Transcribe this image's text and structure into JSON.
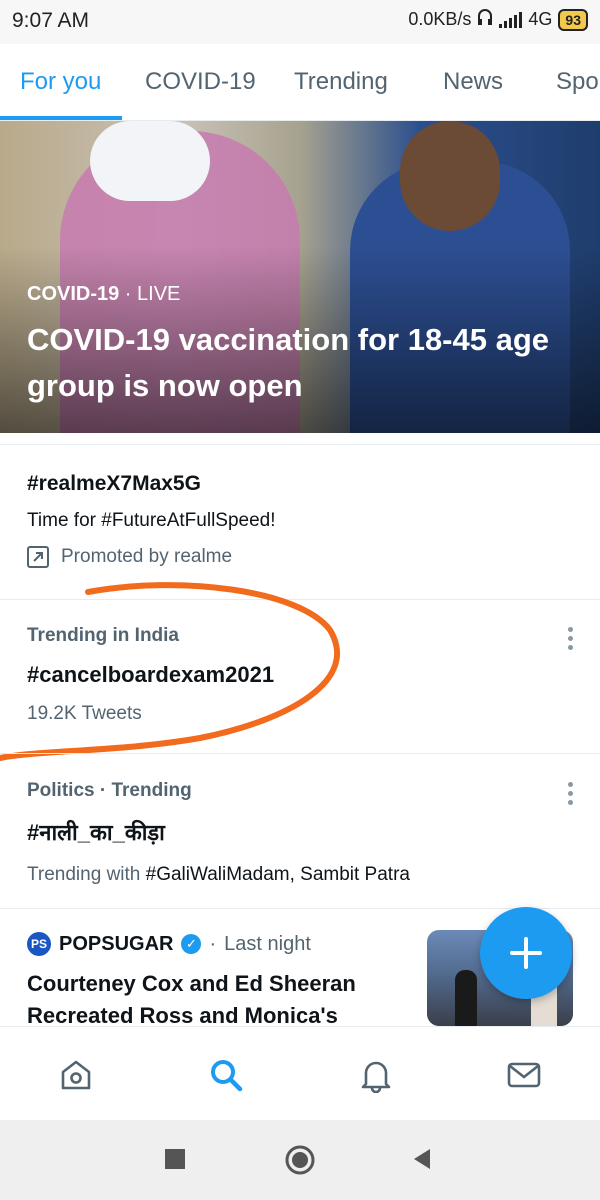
{
  "status_bar": {
    "time": "9:07 AM",
    "network_speed": "0.0KB/s",
    "network_type": "4G",
    "battery": "93"
  },
  "tabs": [
    {
      "label": "For you",
      "active": true
    },
    {
      "label": "COVID-19",
      "active": false
    },
    {
      "label": "Trending",
      "active": false
    },
    {
      "label": "News",
      "active": false
    },
    {
      "label": "Spo",
      "active": false
    }
  ],
  "hero": {
    "category": "COVID-19",
    "separator": " · ",
    "live_label": "LIVE",
    "title": "COVID-19 vaccination for 18-45 age group is now open"
  },
  "promoted": {
    "hashtag": "#realmeX7Max5G",
    "text": "Time for #FutureAtFullSpeed!",
    "promoted_by": "Promoted by realme",
    "icon": "promoted-arrow-icon"
  },
  "trends": [
    {
      "meta": "Trending in India",
      "name": "#cancelboardexam2021",
      "count": "19.2K Tweets"
    },
    {
      "meta": "Politics · Trending",
      "name": "#नाली_का_कीड़ा",
      "with_prefix": "Trending with",
      "with_items": "#GaliWaliMadam, Sambit Patra"
    }
  ],
  "news": {
    "source_logo": "PS",
    "source": "POPSUGAR",
    "time": "Last night",
    "title": "Courteney Cox and Ed Sheeran Recreated Ross and Monica's"
  },
  "fab": {
    "icon": "plus-icon"
  },
  "bottom_nav": [
    {
      "icon": "home-icon",
      "active": false
    },
    {
      "icon": "search-icon",
      "active": true
    },
    {
      "icon": "notifications-icon",
      "active": false
    },
    {
      "icon": "messages-icon",
      "active": false
    }
  ],
  "colors": {
    "accent": "#1d9bf0",
    "secondary_text": "#536471",
    "annotation": "#f26a1b"
  }
}
